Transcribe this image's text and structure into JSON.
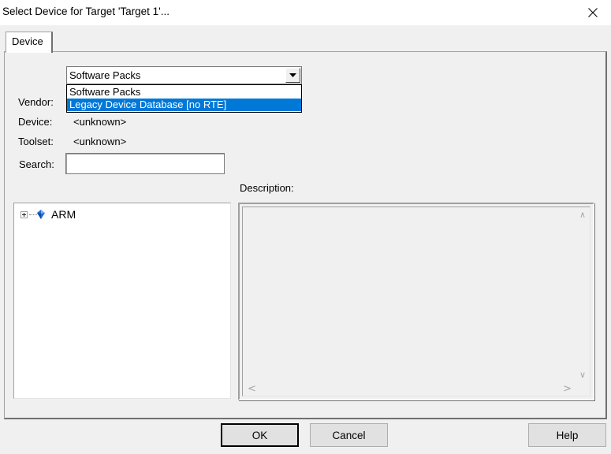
{
  "window": {
    "title": "Select Device for Target 'Target 1'...",
    "close_icon": "close-icon"
  },
  "tabs": [
    {
      "label": "Device",
      "selected": true
    }
  ],
  "source_combo": {
    "value": "Software Packs",
    "options": [
      "Software Packs",
      "Legacy Device Database [no RTE]"
    ],
    "highlighted_option": "Legacy Device Database [no RTE]",
    "open": true
  },
  "fields": {
    "vendor_label": "Vendor:",
    "device_label": "Device:",
    "device_value": "<unknown>",
    "toolset_label": "Toolset:",
    "toolset_value": "<unknown>",
    "search_label": "Search:",
    "search_value": ""
  },
  "description": {
    "label": "Description:",
    "text": ""
  },
  "tree": {
    "items": [
      {
        "label": "ARM",
        "icon": "diamond-chip-icon",
        "expanded": false
      }
    ]
  },
  "buttons": {
    "ok": "OK",
    "cancel": "Cancel",
    "help": "Help"
  },
  "colors": {
    "selection": "#0078d7",
    "dialog_bg": "#f0f0f0"
  }
}
